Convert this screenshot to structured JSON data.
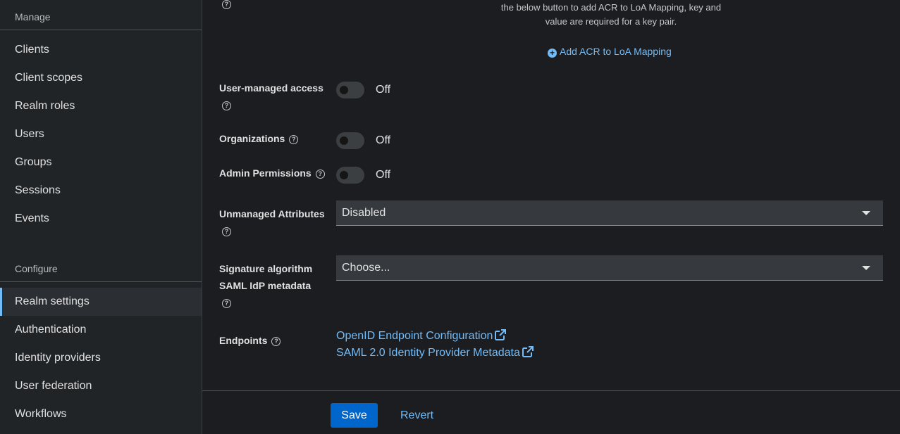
{
  "sidebar": {
    "manage_title": "Manage",
    "manage_items": [
      "Clients",
      "Client scopes",
      "Realm roles",
      "Users",
      "Groups",
      "Sessions",
      "Events"
    ],
    "configure_title": "Configure",
    "configure_items": [
      "Realm settings",
      "Authentication",
      "Identity providers",
      "User federation",
      "Workflows"
    ],
    "active_item": "Realm settings"
  },
  "form": {
    "acr_hint_line1": "the below button to add ACR to LoA Mapping, key and",
    "acr_hint_line2": "value are required for a key pair.",
    "add_acr_label": "Add ACR to LoA Mapping",
    "user_managed_access": {
      "label": "User-managed access",
      "state": "Off"
    },
    "organizations": {
      "label": "Organizations",
      "state": "Off"
    },
    "admin_permissions": {
      "label": "Admin Permissions",
      "state": "Off"
    },
    "unmanaged_attributes": {
      "label": "Unmanaged Attributes",
      "value": "Disabled"
    },
    "signature_algorithm": {
      "label_line1": "Signature algorithm",
      "label_line2": "SAML IdP metadata",
      "value": "Choose..."
    },
    "endpoints": {
      "label": "Endpoints",
      "links": [
        "OpenID Endpoint Configuration",
        "SAML 2.0 Identity Provider Metadata"
      ]
    }
  },
  "footer": {
    "save_label": "Save",
    "revert_label": "Revert"
  },
  "colors": {
    "accent": "#73bcf7",
    "primary_button": "#0066cc",
    "background": "#1b1d21",
    "sidebar": "#212427"
  }
}
